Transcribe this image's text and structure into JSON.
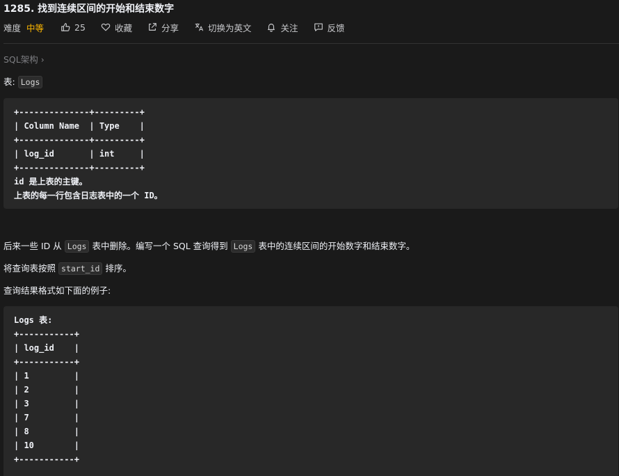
{
  "problem": {
    "title": "1285. 找到连续区间的开始和结束数字",
    "difficulty_label": "难度",
    "difficulty_value": "中等",
    "difficulty_color": "#ffb800",
    "likes": "25",
    "favorite_label": "收藏",
    "share_label": "分享",
    "switch_lang_label": "切换为英文",
    "follow_label": "关注",
    "feedback_label": "反馈"
  },
  "breadcrumb": {
    "label": "SQL架构",
    "chevron": "›"
  },
  "intro": {
    "prefix": "表:",
    "table_name": "Logs"
  },
  "schema_block": {
    "lines": [
      "+--------------+---------+",
      "| Column Name  | Type    |",
      "+--------------+---------+",
      "| log_id       | int     |",
      "+--------------+---------+",
      "id 是上表的主键。",
      "上表的每一行包含日志表中的一个 ID。"
    ]
  },
  "description": {
    "line1_part1": "后来一些 ID 从",
    "line1_code": "Logs",
    "line1_part2": "表中删除。编写一个 SQL 查询得到",
    "line1_code2": "Logs",
    "line1_part3": "表中的连续区间的开始数字和结束数字。",
    "line2_part1": "将查询表按照",
    "line2_code": "start_id",
    "line2_part2": "排序。",
    "line3": "查询结果格式如下面的例子:"
  },
  "example_block": {
    "lines": [
      "Logs 表:",
      "+-----------+",
      "| log_id    |",
      "+-----------+",
      "| 1         |",
      "| 2         |",
      "| 3         |",
      "| 7         |",
      "| 8         |",
      "| 10        |",
      "+-----------+"
    ]
  },
  "icons": {
    "like": "thumbs-up-icon",
    "favorite": "heart-icon",
    "share": "share-icon",
    "translate": "translate-icon",
    "follow": "bell-icon",
    "feedback": "feedback-icon"
  }
}
